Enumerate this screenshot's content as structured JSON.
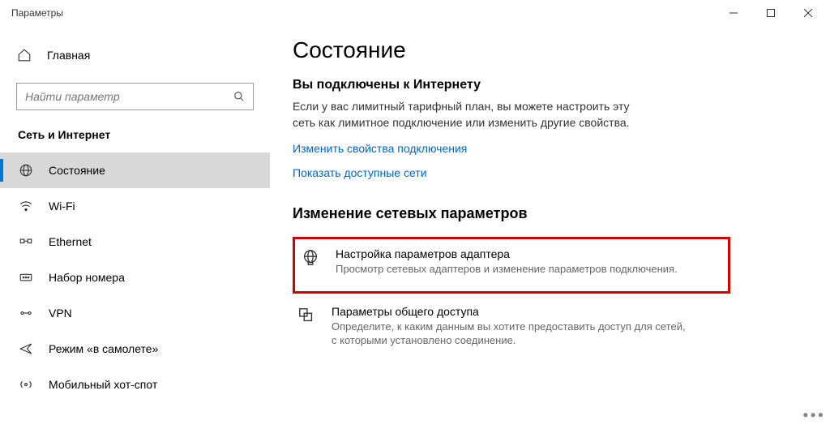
{
  "window": {
    "title": "Параметры"
  },
  "sidebar": {
    "home": "Главная",
    "search_placeholder": "Найти параметр",
    "section": "Сеть и Интернет",
    "items": [
      {
        "label": "Состояние"
      },
      {
        "label": "Wi-Fi"
      },
      {
        "label": "Ethernet"
      },
      {
        "label": "Набор номера"
      },
      {
        "label": "VPN"
      },
      {
        "label": "Режим «в самолете»"
      },
      {
        "label": "Мобильный хот-спот"
      }
    ]
  },
  "content": {
    "title": "Состояние",
    "connected_h": "Вы подключены к Интернету",
    "connected_p": "Если у вас лимитный тарифный план, вы можете настроить эту сеть как лимитное подключение или изменить другие свойства.",
    "link1": "Изменить свойства подключения",
    "link2": "Показать доступные сети",
    "change_h": "Изменение сетевых параметров",
    "option1": {
      "title": "Настройка параметров адаптера",
      "desc": "Просмотр сетевых адаптеров и изменение параметров подключения."
    },
    "option2": {
      "title": "Параметры общего доступа",
      "desc": "Определите, к каким данным вы хотите предоставить доступ для сетей, с которыми установлено соединение."
    }
  }
}
